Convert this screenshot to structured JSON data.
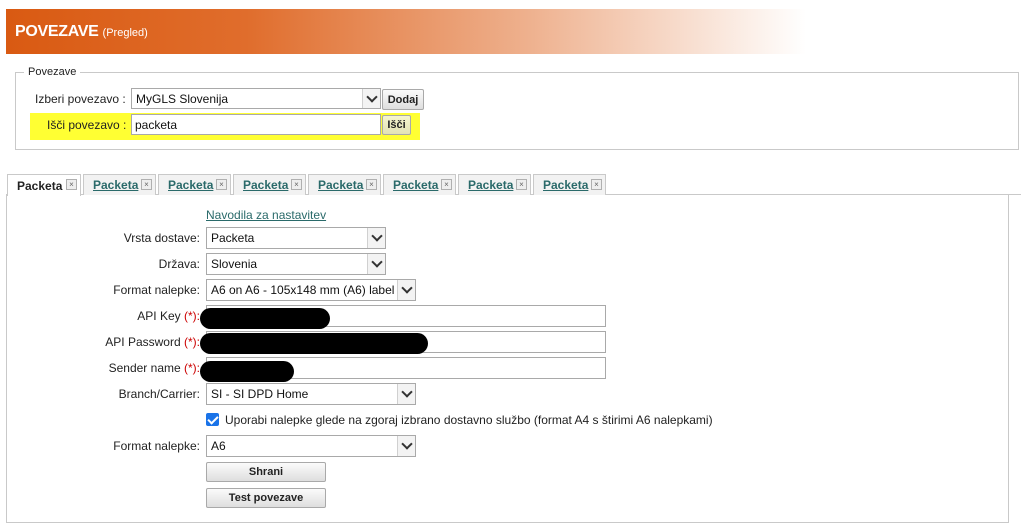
{
  "header": {
    "title": "POVEZAVE",
    "subtitle": "(Pregled)"
  },
  "connections": {
    "legend": "Povezave",
    "select_label": "Izberi povezavo :",
    "select_value": "MyGLS Slovenija",
    "add_button": "Dodaj",
    "search_label": "Išči povezavo :",
    "search_value": "packeta",
    "search_button": "Išči"
  },
  "tabs": [
    {
      "label": "Packeta",
      "active": true
    },
    {
      "label": "Packeta"
    },
    {
      "label": "Packeta"
    },
    {
      "label": "Packeta"
    },
    {
      "label": "Packeta"
    },
    {
      "label": "Packeta"
    },
    {
      "label": "Packeta"
    },
    {
      "label": "Packeta"
    }
  ],
  "form": {
    "instructions_link": "Navodila za nastavitev",
    "delivery_type_label": "Vrsta dostave:",
    "delivery_type_value": "Packeta",
    "country_label": "Država:",
    "country_value": "Slovenia",
    "label_format_label": "Format nalepke:",
    "label_format_value": "A6 on A6 - 105x148 mm (A6) label",
    "api_key_label": "API Key",
    "api_password_label": "API Password",
    "sender_name_label": "Sender name",
    "required_mark": "(*):",
    "branch_label": "Branch/Carrier:",
    "branch_value": "SI - SI DPD Home",
    "checkbox_label": "Uporabi nalepke glede na zgoraj izbrano dostavno službo (format A4 s štirimi A6 nalepkami)",
    "label_format2_label": "Format nalepke:",
    "label_format2_value": "A6",
    "save_button": "Shrani",
    "test_button": "Test povezave"
  }
}
